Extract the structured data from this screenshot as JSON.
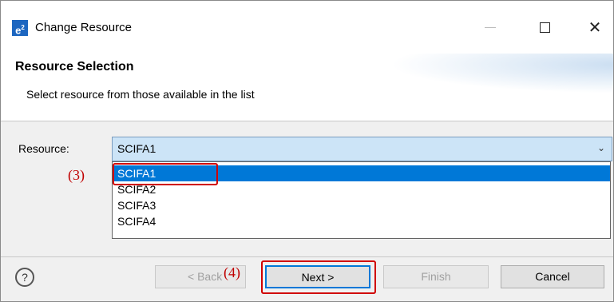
{
  "window": {
    "app_icon_text": "e²",
    "title": "Change Resource",
    "minimize_icon": "minimize-icon",
    "maximize_icon": "maximize-icon",
    "close_label": "✕"
  },
  "header": {
    "title": "Resource Selection",
    "description": "Select resource from those available in the list"
  },
  "form": {
    "resource_label": "Resource:",
    "selected_value": "SCIFA1",
    "options": [
      "SCIFA1",
      "SCIFA2",
      "SCIFA3",
      "SCIFA4"
    ]
  },
  "annotations": {
    "step3": "(3)",
    "step4": "(4)"
  },
  "footer": {
    "help_label": "?",
    "back_label": "< Back",
    "next_label": "Next >",
    "finish_label": "Finish",
    "cancel_label": "Cancel"
  },
  "colors": {
    "selection": "#0078d7",
    "annotation": "#d00000",
    "combo_background": "#cce4f7"
  }
}
